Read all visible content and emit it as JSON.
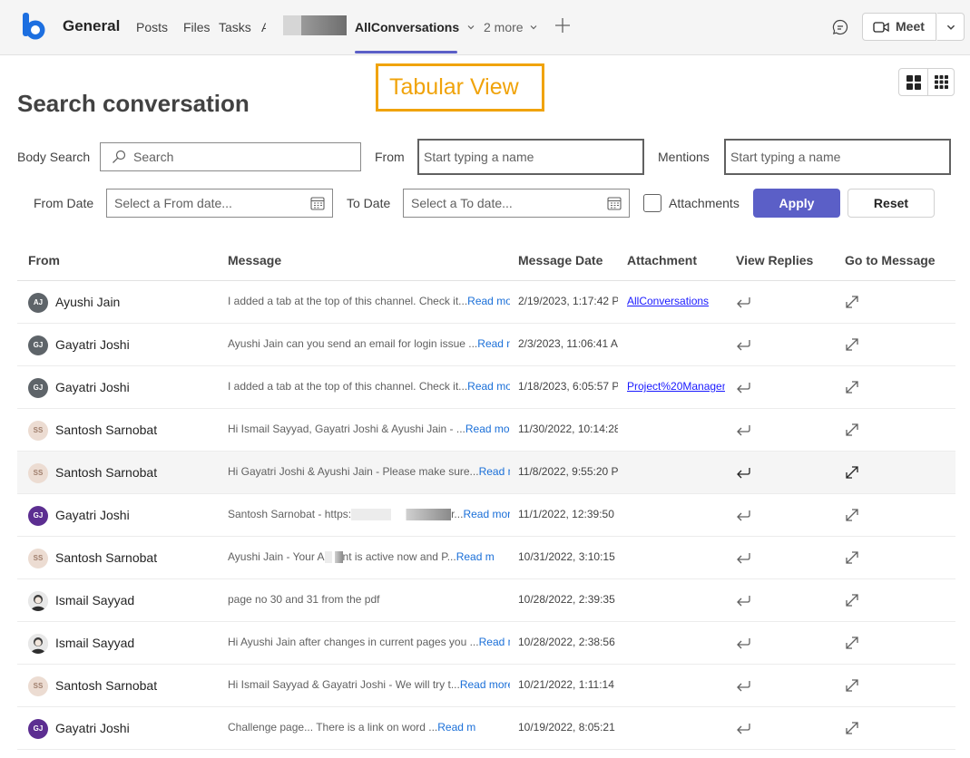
{
  "header": {
    "channel_title": "General",
    "tabs": [
      "Posts",
      "Files",
      "Tasks",
      "A"
    ],
    "active_tab": "AllConversations",
    "more_label": "2 more",
    "meet_label": "Meet"
  },
  "annotation": {
    "label": "Tabular View"
  },
  "page_title": "Search conversation",
  "filters": {
    "body_search_label": "Body Search",
    "search_placeholder": "Search",
    "from_label": "From",
    "from_placeholder": "Start typing a name",
    "mentions_label": "Mentions",
    "mentions_placeholder": "Start typing a name",
    "from_date_label": "From Date",
    "from_date_placeholder": "Select a From date...",
    "to_date_label": "To Date",
    "to_date_placeholder": "Select a To date...",
    "attachments_label": "Attachments",
    "apply_label": "Apply",
    "reset_label": "Reset"
  },
  "table": {
    "columns": [
      "From",
      "Message",
      "Message Date",
      "Attachment",
      "View Replies",
      "Go to Message"
    ],
    "rows": [
      {
        "initials": "AJ",
        "avatar": "grey",
        "from": "Ayushi Jain",
        "message": "I added a tab at the top of this channel. Check it...",
        "read_more": "Read mo",
        "date": "2/19/2023, 1:17:42 P",
        "attachment": "AllConversations"
      },
      {
        "initials": "GJ",
        "avatar": "grey",
        "from": "Gayatri Joshi",
        "message": "Ayushi Jain can you send an email for login issue ...",
        "read_more": "Read m",
        "date": "2/3/2023, 11:06:41 A",
        "attachment": ""
      },
      {
        "initials": "GJ",
        "avatar": "grey",
        "from": "Gayatri Joshi",
        "message": "I added a tab at the top of this channel. Check it...",
        "read_more": "Read mo",
        "date": "1/18/2023, 6:05:57 P",
        "attachment": "Project%20Managen"
      },
      {
        "initials": "SS",
        "avatar": "peach",
        "from": "Santosh Sarnobat",
        "message": "Hi Ismail Sayyad, Gayatri Joshi & Ayushi Jain - ...",
        "read_more": "Read more",
        "date": "11/30/2022, 10:14:28",
        "attachment": ""
      },
      {
        "initials": "SS",
        "avatar": "peach",
        "from": "Santosh Sarnobat",
        "message": "Hi Gayatri Joshi & Ayushi Jain - Please make sure...",
        "read_more": "Read mo",
        "date": "11/8/2022, 9:55:20 P",
        "attachment": ""
      },
      {
        "initials": "GJ",
        "avatar": "purple",
        "from": "Gayatri Joshi",
        "message": "Santosh Sarnobat - https:",
        "message_tail": "r...",
        "read_more": "Read mor",
        "date": "11/1/2022, 12:39:50",
        "attachment": ""
      },
      {
        "initials": "SS",
        "avatar": "peach",
        "from": "Santosh Sarnobat",
        "message": "Ayushi Jain - Your A",
        "message_tail": "nt is active now and P...",
        "read_more": "Read m",
        "date": "10/31/2022, 3:10:15",
        "attachment": ""
      },
      {
        "initials": "",
        "avatar": "photo",
        "from": "Ismail Sayyad",
        "message": "page no 30 and 31 from the pdf",
        "read_more": "",
        "date": "10/28/2022, 2:39:35",
        "attachment": ""
      },
      {
        "initials": "",
        "avatar": "photo",
        "from": "Ismail Sayyad",
        "message": "Hi Ayushi Jain after changes in current pages you ...",
        "read_more": "Read m",
        "date": "10/28/2022, 2:38:56",
        "attachment": ""
      },
      {
        "initials": "SS",
        "avatar": "peach",
        "from": "Santosh Sarnobat",
        "message": "Hi Ismail Sayyad & Gayatri Joshi - We will try t...",
        "read_more": "Read more",
        "date": "10/21/2022, 1:11:14",
        "attachment": ""
      },
      {
        "initials": "GJ",
        "avatar": "purple",
        "from": "Gayatri Joshi",
        "message": "Challenge page... There is a link on word ...",
        "read_more": "Read m",
        "date": "10/19/2022, 8:05:21",
        "attachment": ""
      }
    ]
  },
  "colors": {
    "accent": "#5b5fc7",
    "annotation": "#f0a30a",
    "link": "#1a6fd8"
  }
}
